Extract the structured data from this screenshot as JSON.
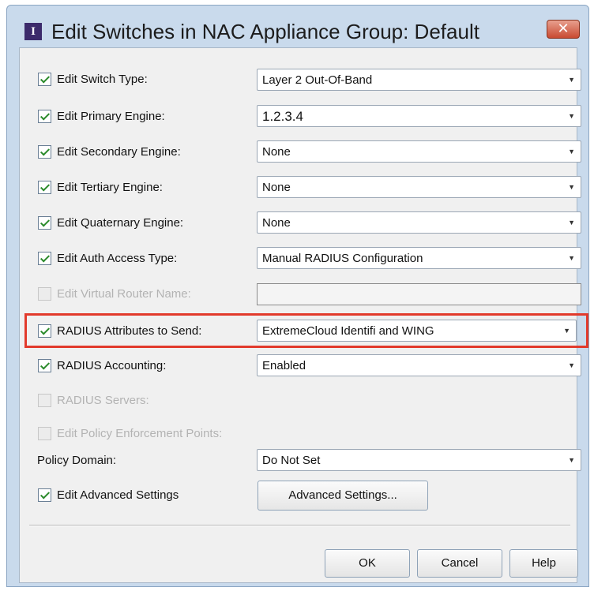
{
  "window": {
    "title": "Edit Switches in NAC Appliance Group: Default",
    "app_icon": "I",
    "close_glyph": "✕"
  },
  "rows": {
    "switch_type": {
      "label": "Edit Switch Type:",
      "checked": true,
      "value": "Layer 2 Out-Of-Band"
    },
    "primary_engine": {
      "label": "Edit Primary Engine:",
      "checked": true,
      "value": "1.2.3.4"
    },
    "secondary_engine": {
      "label": "Edit Secondary Engine:",
      "checked": true,
      "value": "None"
    },
    "tertiary_engine": {
      "label": "Edit Tertiary Engine:",
      "checked": true,
      "value": "None"
    },
    "quaternary_engine": {
      "label": "Edit Quaternary Engine:",
      "checked": true,
      "value": "None"
    },
    "auth_access_type": {
      "label": "Edit Auth Access Type:",
      "checked": true,
      "value": "Manual RADIUS Configuration"
    },
    "virtual_router": {
      "label": "Edit Virtual Router Name:",
      "checked": false,
      "disabled": true,
      "value": ""
    },
    "radius_attributes": {
      "label": "RADIUS Attributes to Send:",
      "checked": true,
      "value": "ExtremeCloud Identifi and WING"
    },
    "radius_accounting": {
      "label": "RADIUS Accounting:",
      "checked": true,
      "value": "Enabled"
    },
    "radius_servers": {
      "label": "RADIUS Servers:",
      "checked": false,
      "disabled": true
    },
    "policy_enforcement": {
      "label": "Edit Policy Enforcement Points:",
      "checked": false,
      "disabled": true
    },
    "policy_domain": {
      "label": "Policy Domain:",
      "value": "Do Not Set"
    },
    "advanced_settings": {
      "label": "Edit Advanced Settings",
      "checked": true,
      "button_label": "Advanced Settings..."
    }
  },
  "buttons": {
    "ok": "OK",
    "cancel": "Cancel",
    "help": "Help"
  },
  "colors": {
    "highlight": "#e23a2c",
    "checkmark": "#2a8a2a",
    "title_bar": "#c9daec"
  },
  "icons": {
    "dropdown": "chevron-down-icon",
    "close": "close-icon"
  }
}
